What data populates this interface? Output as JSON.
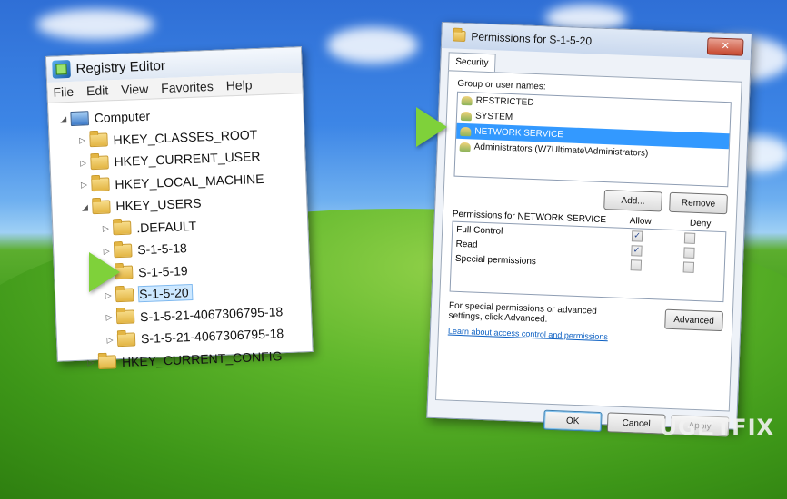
{
  "registry_editor": {
    "title": "Registry Editor",
    "menu": [
      "File",
      "Edit",
      "View",
      "Favorites",
      "Help"
    ],
    "tree": [
      {
        "label": "Computer",
        "level": 0,
        "expanded": true
      },
      {
        "label": "HKEY_CLASSES_ROOT",
        "level": 1
      },
      {
        "label": "HKEY_CURRENT_USER",
        "level": 1
      },
      {
        "label": "HKEY_LOCAL_MACHINE",
        "level": 1
      },
      {
        "label": "HKEY_USERS",
        "level": 1,
        "expanded": true
      },
      {
        "label": ".DEFAULT",
        "level": 2
      },
      {
        "label": "S-1-5-18",
        "level": 2
      },
      {
        "label": "S-1-5-19",
        "level": 2
      },
      {
        "label": "S-1-5-20",
        "level": 2,
        "selected": true
      },
      {
        "label": "S-1-5-21-4067306795-18",
        "level": 2
      },
      {
        "label": "S-1-5-21-4067306795-18",
        "level": 2
      },
      {
        "label": "HKEY_CURRENT_CONFIG",
        "level": 1
      }
    ]
  },
  "permissions_dialog": {
    "title": "Permissions for S-1-5-20",
    "close": "✕",
    "tab": "Security",
    "group_label": "Group or user names:",
    "users": [
      {
        "name": "RESTRICTED"
      },
      {
        "name": "SYSTEM"
      },
      {
        "name": "NETWORK SERVICE",
        "selected": true
      },
      {
        "name": "Administrators (W7Ultimate\\Administrators)"
      }
    ],
    "add_button": "Add...",
    "remove_button": "Remove",
    "permissions_label": "Permissions for NETWORK SERVICE",
    "allow_header": "Allow",
    "deny_header": "Deny",
    "permissions": [
      {
        "name": "Full Control",
        "allow": true,
        "deny": false
      },
      {
        "name": "Read",
        "allow": true,
        "deny": false
      },
      {
        "name": "Special permissions",
        "allow": false,
        "deny": false
      }
    ],
    "special_note": "For special permissions or advanced settings, click Advanced.",
    "advanced_button": "Advanced",
    "learn_link": "Learn about access control and permissions",
    "ok_button": "OK",
    "cancel_button": "Cancel",
    "apply_button": "Apply"
  },
  "watermark": "UG⊏TFIX",
  "accent_color": "#7fd13a"
}
